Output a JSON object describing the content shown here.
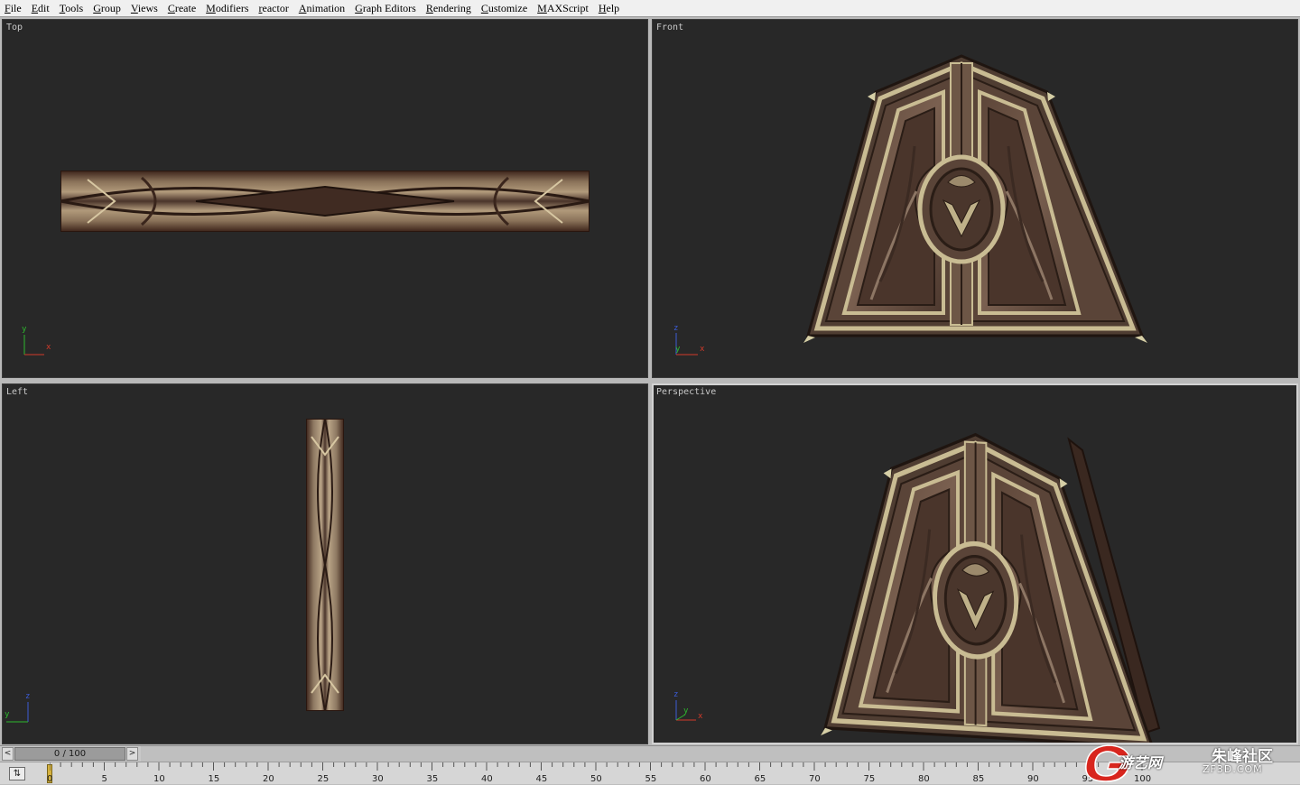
{
  "menu": {
    "items": [
      "File",
      "Edit",
      "Tools",
      "Group",
      "Views",
      "Create",
      "Modifiers",
      "reactor",
      "Animation",
      "Graph Editors",
      "Rendering",
      "Customize",
      "MAXScript",
      "Help"
    ]
  },
  "viewports": {
    "top": {
      "label": "Top",
      "axis": [
        "y",
        "x"
      ]
    },
    "front": {
      "label": "Front",
      "axis": [
        "z",
        "y",
        "x"
      ]
    },
    "left": {
      "label": "Left",
      "axis": [
        "z",
        "y"
      ]
    },
    "perspective": {
      "label": "Perspective",
      "axis": [
        "z",
        "y",
        "x"
      ]
    }
  },
  "timeslider": {
    "frame_text": "0 / 100",
    "prev_glyph": "<",
    "next_glyph": ">",
    "current_frame": 0,
    "total_frames": 100
  },
  "timeline": {
    "ticks": [
      "0",
      "5",
      "10",
      "15",
      "20",
      "25",
      "30",
      "35",
      "40",
      "45",
      "50",
      "55",
      "60",
      "65",
      "70",
      "75",
      "80",
      "85",
      "90",
      "95",
      "100"
    ],
    "key_icon": "key-mode-icon"
  },
  "watermark": {
    "site_name": "游艺网",
    "community": "朱峰社区",
    "domain": "ZF3D.COM"
  },
  "colors": {
    "viewport_bg": "#282828",
    "wood_dark": "#3a2a22",
    "wood_mid": "#6b5446",
    "wood_light": "#a68e70",
    "trim": "#c9bc93",
    "axis_x": "#d23a2a",
    "axis_y": "#2eb82e",
    "axis_z": "#3b5bd6",
    "playhead": "#d6b23d"
  }
}
